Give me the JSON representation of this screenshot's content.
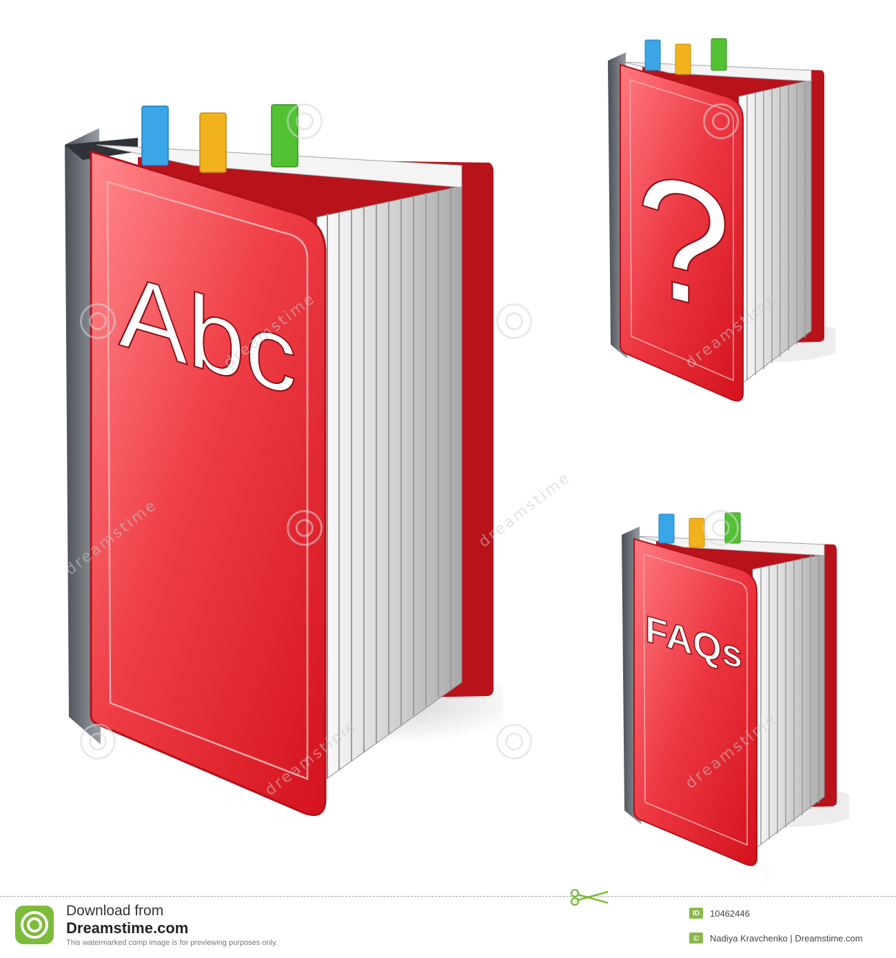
{
  "books": [
    {
      "cover_text": "Abc",
      "cover_color": "#e8202a",
      "tab_colors": [
        "#3aa6e8",
        "#f2b21d",
        "#52c233"
      ]
    },
    {
      "cover_text": "?",
      "cover_color": "#e8202a",
      "tab_colors": [
        "#3aa6e8",
        "#f2b21d",
        "#52c233"
      ]
    },
    {
      "cover_text": "FAQs",
      "cover_color": "#e8202a",
      "tab_colors": [
        "#3aa6e8",
        "#f2b21d",
        "#52c233"
      ]
    }
  ],
  "watermark": {
    "text": "dreamstime"
  },
  "footer": {
    "download_label": "Download from",
    "site_label": "Dreamstime.com",
    "notice": "This watermarked comp image is for previewing purposes only.",
    "id_badge": "ID",
    "id_value": "10462446",
    "copyright_badge": "©",
    "credit": "Nadiya Kravchenko | Dreamstime.com",
    "accent_color": "#7dbb3a"
  }
}
